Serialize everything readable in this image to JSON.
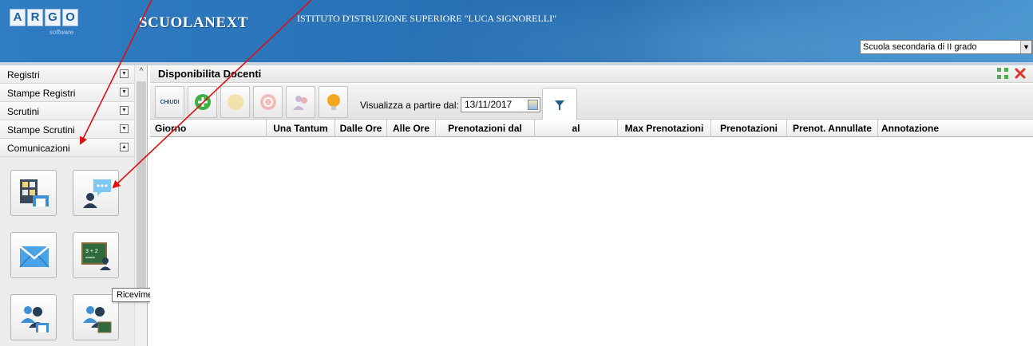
{
  "header": {
    "logo_letters": [
      "A",
      "R",
      "G",
      "O"
    ],
    "logo_sub": "software",
    "brand": "SCUOLANEXT",
    "school_name": "ISTITUTO D'ISTRUZIONE SUPERIORE \"LUCA SIGNORELLI\"",
    "school_type_selected": "Scuola secondaria di II grado"
  },
  "sidebar": {
    "items": [
      {
        "label": "Registri"
      },
      {
        "label": "Stampe Registri"
      },
      {
        "label": "Scrutini"
      },
      {
        "label": "Stampe Scrutini"
      },
      {
        "label": "Comunicazioni"
      }
    ],
    "icons": [
      "bacheca-icon",
      "ricevimento-docenti-icon",
      "messaggi-icon",
      "lavagna-icon",
      "gruppi-classe-icon",
      "gruppi-docenti-icon"
    ],
    "tooltip": "Ricevimento Docenti"
  },
  "main": {
    "title": "Disponibilita Docenti",
    "toolbar": {
      "close_label": "CHIUDI",
      "date_label": "Visualizza a partire dal:",
      "date_value": "13/11/2017"
    },
    "columns": [
      "Giorno",
      "Una Tantum",
      "Dalle Ore",
      "Alle Ore",
      "Prenotazioni dal",
      "al",
      "Max Prenotazioni",
      "Prenotazioni",
      "Prenot. Annullate",
      "Annotazione"
    ]
  },
  "colors": {
    "header_blue": "#2a73b8",
    "add_green": "#3cb043",
    "close_red": "#e0342c",
    "expand_green": "#4caf50",
    "bulb_orange": "#f5a623",
    "arrow_red": "#e01010"
  }
}
